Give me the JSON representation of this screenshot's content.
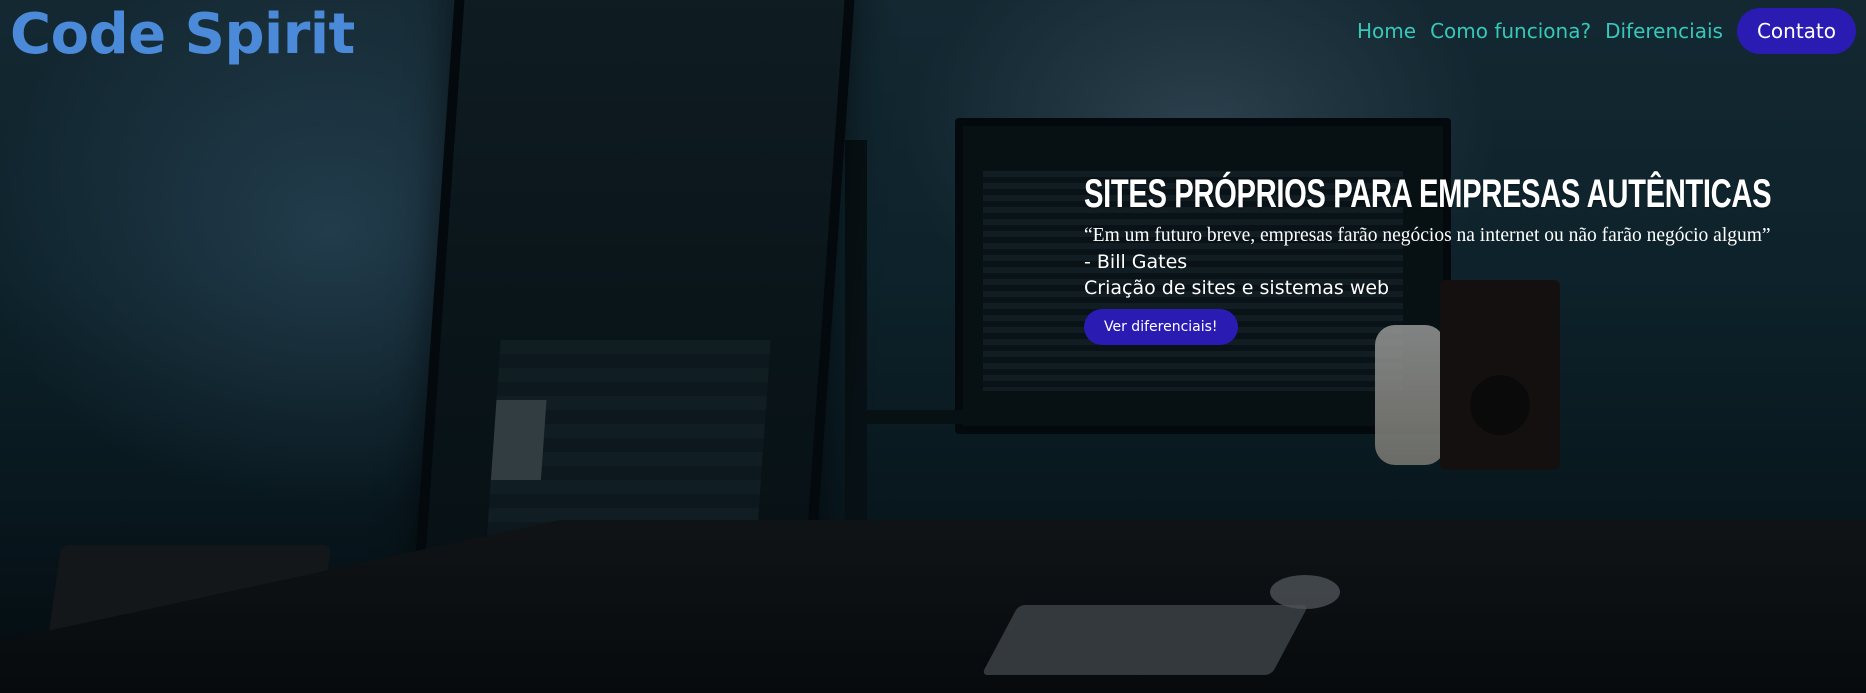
{
  "brand": {
    "name": "Code Spirit",
    "color": "#4a8ad9"
  },
  "nav": {
    "items": [
      {
        "label": "Home"
      },
      {
        "label": "Como funciona?"
      },
      {
        "label": "Diferenciais"
      }
    ],
    "cta_label": "Contato",
    "link_color": "#36c8b8",
    "cta_color": "#2a1bb3"
  },
  "hero": {
    "headline": "SITES PRÓPRIOS PARA EMPRESAS AUTÊNTICAS",
    "quote": "“Em um futuro breve, empresas farão negócios na internet ou não farão negócio algum”",
    "author": "- Bill Gates",
    "tagline": "Criação de sites e sistemas web",
    "cta_label": "Ver diferenciais!"
  }
}
